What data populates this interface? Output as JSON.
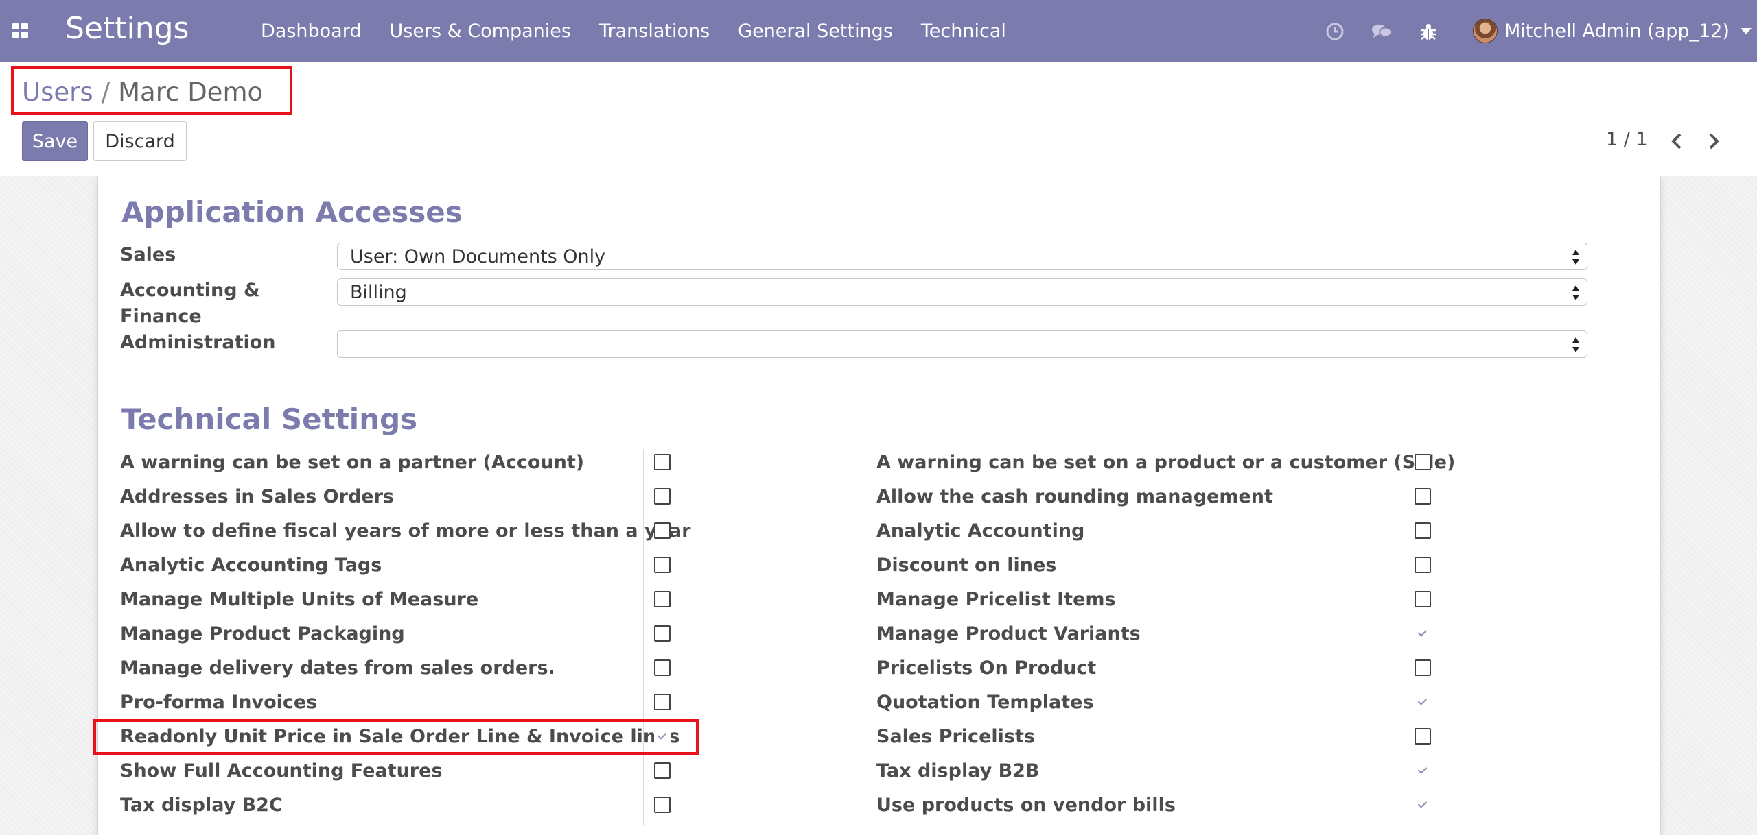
{
  "navbar": {
    "brand": "Settings",
    "menu": [
      "Dashboard",
      "Users & Companies",
      "Translations",
      "General Settings",
      "Technical"
    ],
    "icons": [
      "clock-icon",
      "chat-icon",
      "bug-icon"
    ],
    "user": "Mitchell Admin (app_12)"
  },
  "breadcrumb": {
    "parent": "Users",
    "separator": "/",
    "current": "Marc Demo"
  },
  "buttons": {
    "save": "Save",
    "discard": "Discard"
  },
  "pager": {
    "value": "1 / 1"
  },
  "application_accesses": {
    "title": "Application Accesses",
    "fields": [
      {
        "label": "Sales",
        "value": "User: Own Documents Only"
      },
      {
        "label": "Accounting & Finance",
        "value": "Billing"
      },
      {
        "label": "Administration",
        "value": ""
      }
    ]
  },
  "technical_settings": {
    "title": "Technical Settings",
    "left": [
      {
        "label": "A warning can be set on a partner (Account)",
        "checked": false
      },
      {
        "label": "Addresses in Sales Orders",
        "checked": false
      },
      {
        "label": "Allow to define fiscal years of more or less than a year",
        "checked": false
      },
      {
        "label": "Analytic Accounting Tags",
        "checked": false
      },
      {
        "label": "Manage Multiple Units of Measure",
        "checked": false
      },
      {
        "label": "Manage Product Packaging",
        "checked": false
      },
      {
        "label": "Manage delivery dates from sales orders.",
        "checked": false
      },
      {
        "label": "Pro-forma Invoices",
        "checked": false
      },
      {
        "label": "Readonly Unit Price in Sale Order Line & Invoice lines",
        "checked": true
      },
      {
        "label": "Show Full Accounting Features",
        "checked": false
      },
      {
        "label": "Tax display B2C",
        "checked": false
      }
    ],
    "right": [
      {
        "label": "A warning can be set on a product or a customer (Sale)",
        "checked": false
      },
      {
        "label": "Allow the cash rounding management",
        "checked": false
      },
      {
        "label": "Analytic Accounting",
        "checked": false
      },
      {
        "label": "Discount on lines",
        "checked": false
      },
      {
        "label": "Manage Pricelist Items",
        "checked": false
      },
      {
        "label": "Manage Product Variants",
        "checked": true
      },
      {
        "label": "Pricelists On Product",
        "checked": false
      },
      {
        "label": "Quotation Templates",
        "checked": true
      },
      {
        "label": "Sales Pricelists",
        "checked": false
      },
      {
        "label": "Tax display B2B",
        "checked": true
      },
      {
        "label": "Use products on vendor bills",
        "checked": true
      }
    ]
  }
}
